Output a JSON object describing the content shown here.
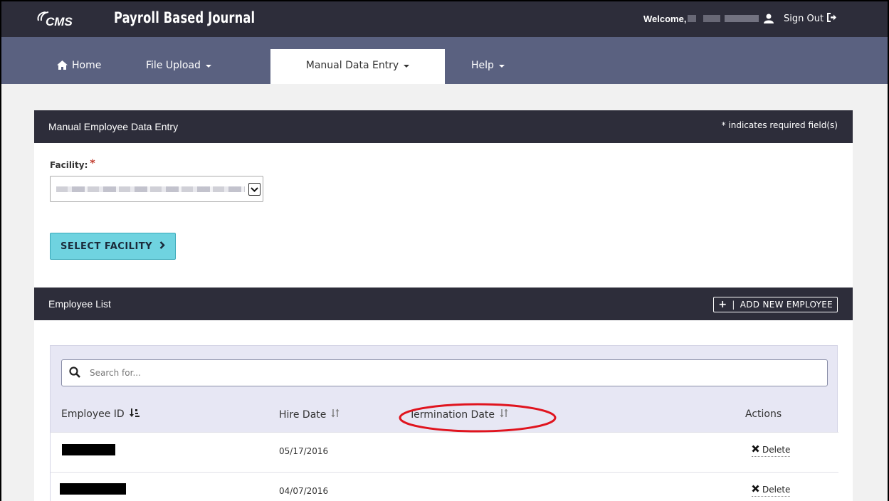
{
  "header": {
    "logo_text": "CMS",
    "app_title": "Payroll Based Journal",
    "welcome_label": "Welcome,",
    "sign_out_label": "Sign Out"
  },
  "nav": {
    "items": [
      {
        "label": "Home",
        "icon": "home-icon"
      },
      {
        "label": "File Upload"
      },
      {
        "label": "Manual Data Entry",
        "active": true
      },
      {
        "label": "Help"
      }
    ]
  },
  "manual_entry": {
    "title": "Manual Employee Data Entry",
    "required_note": "* indicates required field(s)",
    "facility_label": "Facility:",
    "required_star": "*",
    "select_facility_label": "SELECT FACILITY"
  },
  "employee_list": {
    "title": "Employee List",
    "add_button_plus": "+",
    "add_button_sep": "|",
    "add_button_label": "ADD NEW EMPLOYEE",
    "search_placeholder": "Search for...",
    "columns": {
      "employee_id": "Employee ID",
      "hire_date": "Hire Date",
      "termination_date": "Termination Date",
      "actions": "Actions"
    },
    "rows": [
      {
        "hire_date": "05/17/2016",
        "action": "Delete"
      },
      {
        "hire_date": "04/07/2016",
        "action": "Delete"
      }
    ]
  },
  "colors": {
    "topbar": "#2d2d3a",
    "navbar": "#5a6180",
    "accent_button": "#6fd3e0",
    "annotation": "#e0141e",
    "required": "#c0392b"
  }
}
